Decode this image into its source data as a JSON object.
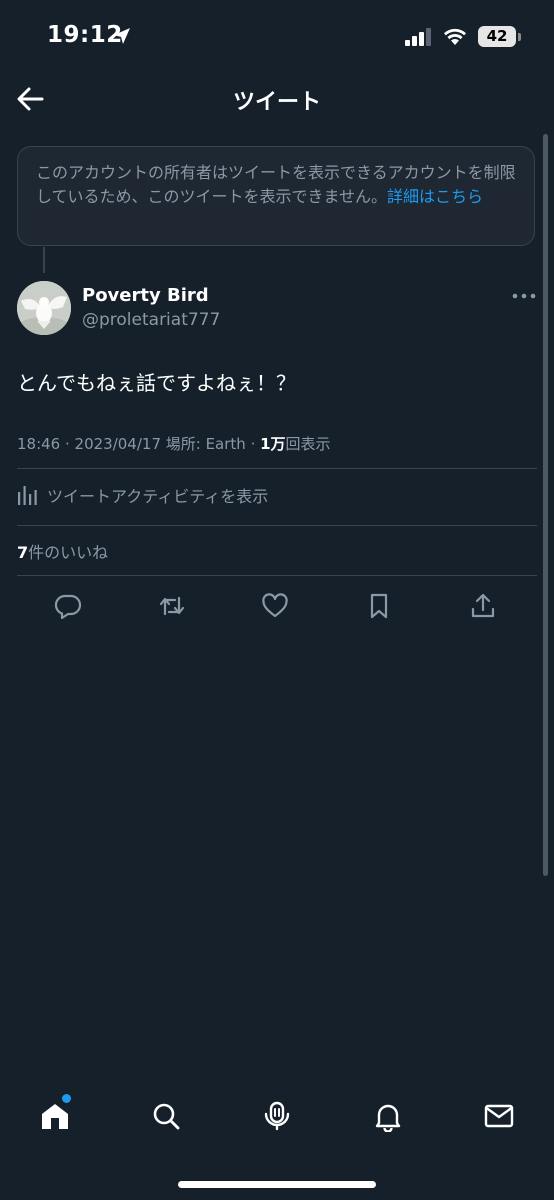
{
  "status_bar": {
    "time": "19:12",
    "battery": "42",
    "icons": [
      "location-arrow-icon",
      "cellular-signal-icon",
      "wifi-icon",
      "battery-icon"
    ]
  },
  "nav": {
    "title": "ツイート",
    "back_icon": "arrow-left-icon"
  },
  "notice": {
    "text": "このアカウントの所有者はツイートを表示できるアカウントを制限しているため、このツイートを表示できません。",
    "link": "詳細はこちら"
  },
  "tweet": {
    "display_name": "Poverty Bird",
    "handle": "@proletariat777",
    "text": "とんでもねぇ話ですよねぇ！？",
    "time": "18:46 · 2023/04/17 場所: Earth · ",
    "views_count": "1万",
    "views_label": "回表示",
    "activity_label": "ツイートアクティビティを表示",
    "likes_count": "7",
    "likes_label": "件のいいね"
  },
  "actions": [
    "reply-icon",
    "retweet-icon",
    "like-icon",
    "bookmark-icon",
    "share-icon"
  ],
  "tabbar": [
    "home-icon",
    "search-icon",
    "spaces-icon",
    "notifications-icon",
    "messages-icon"
  ],
  "colors": {
    "background": "#15202b",
    "accent": "#1d9bf0",
    "secondary_text": "#8b98a5",
    "border": "#38444d"
  }
}
